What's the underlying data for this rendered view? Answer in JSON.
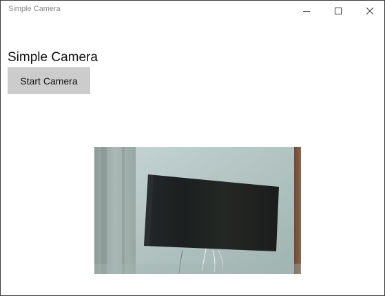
{
  "window": {
    "title": "Simple Camera"
  },
  "app": {
    "title": "Simple Camera",
    "start_button_label": "Start Camera"
  },
  "icons": {
    "minimize": "minimize-icon",
    "maximize": "maximize-icon",
    "close": "close-icon"
  },
  "colors": {
    "button_bg": "#cccccc",
    "title_text": "#8a8a8a"
  }
}
